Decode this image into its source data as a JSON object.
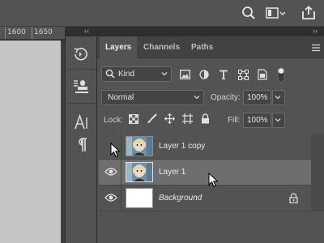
{
  "ruler": {
    "marks": [
      "1600",
      "1650"
    ]
  },
  "panels": {
    "tabs": [
      {
        "label": "Layers",
        "active": true
      },
      {
        "label": "Channels",
        "active": false
      },
      {
        "label": "Paths",
        "active": false
      }
    ],
    "collapse_left": "‹‹",
    "collapse_right": "››"
  },
  "filter": {
    "kind_label": "Kind"
  },
  "blend": {
    "mode": "Normal",
    "opacity_label": "Opacity:",
    "opacity_value": "100%"
  },
  "lock": {
    "label": "Lock:",
    "fill_label": "Fill:",
    "fill_value": "100%"
  },
  "layers": [
    {
      "name": "Layer 1 copy",
      "visible": false,
      "selected": false,
      "italic": false,
      "locked": false
    },
    {
      "name": "Layer 1",
      "visible": true,
      "selected": true,
      "italic": false,
      "locked": false
    },
    {
      "name": "Background",
      "visible": true,
      "selected": false,
      "italic": true,
      "locked": true
    }
  ],
  "icons": {
    "topbar": [
      "search-icon",
      "workspace-icon",
      "share-icon"
    ],
    "dock": [
      "history-icon",
      "properties-icon",
      "character-icon",
      "paragraph-icon"
    ],
    "filters": [
      "image-filter-icon",
      "adjustment-filter-icon",
      "type-filter-icon",
      "shape-filter-icon",
      "smart-object-filter-icon",
      "filter-toggle-icon"
    ],
    "locks": [
      "lock-transparent-icon",
      "lock-image-icon",
      "lock-position-icon",
      "lock-artboard-icon",
      "lock-all-icon"
    ]
  },
  "colors": {
    "panel": "#535353",
    "selected_row": "#6e6e6e",
    "canvas": "#c6c6c6"
  }
}
